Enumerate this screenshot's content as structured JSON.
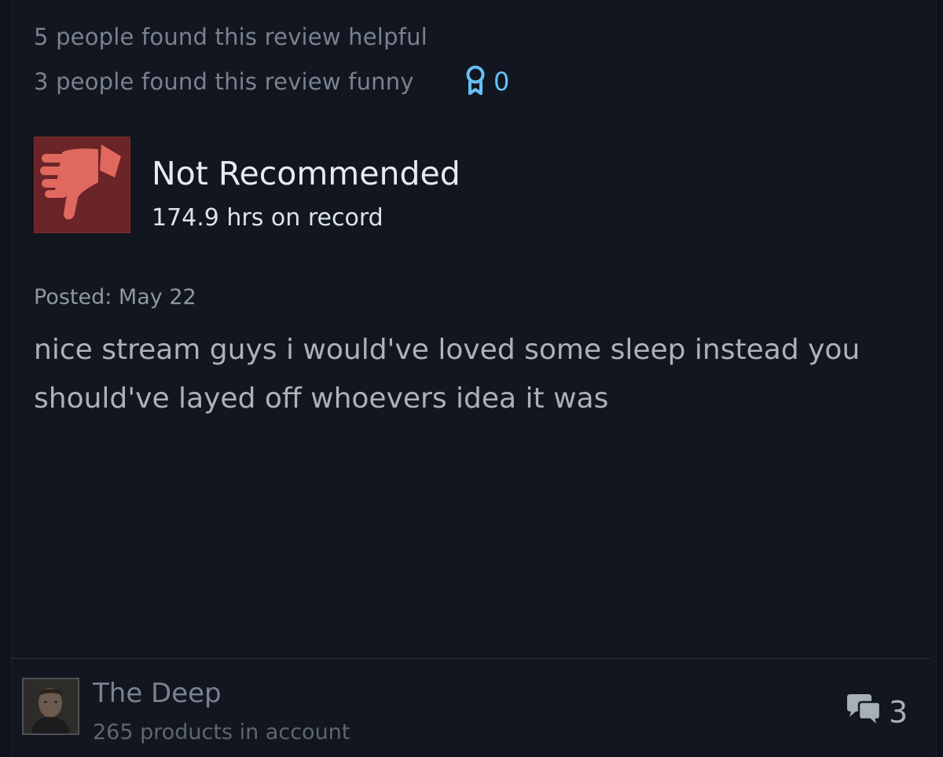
{
  "review": {
    "helpful_text": "5 people found this review helpful",
    "funny_text": "3 people found this review funny",
    "award_count": "0",
    "recommendation": "Not Recommended",
    "hours": "174.9 hrs on record",
    "posted": "Posted: May 22",
    "body": "nice stream guys i would've loved some sleep instead you should've layed off whoevers idea it was",
    "thumb_icon": "thumbs-down-icon",
    "award_icon": "award-ribbon-icon"
  },
  "author": {
    "name": "The Deep",
    "products": "265 products in account",
    "comment_count": "3",
    "comment_icon": "comments-icon"
  },
  "colors": {
    "background": "#111620",
    "thumb_bg": "#6b2427",
    "thumb_icon": "#e0685e",
    "award": "#66c0f4"
  }
}
